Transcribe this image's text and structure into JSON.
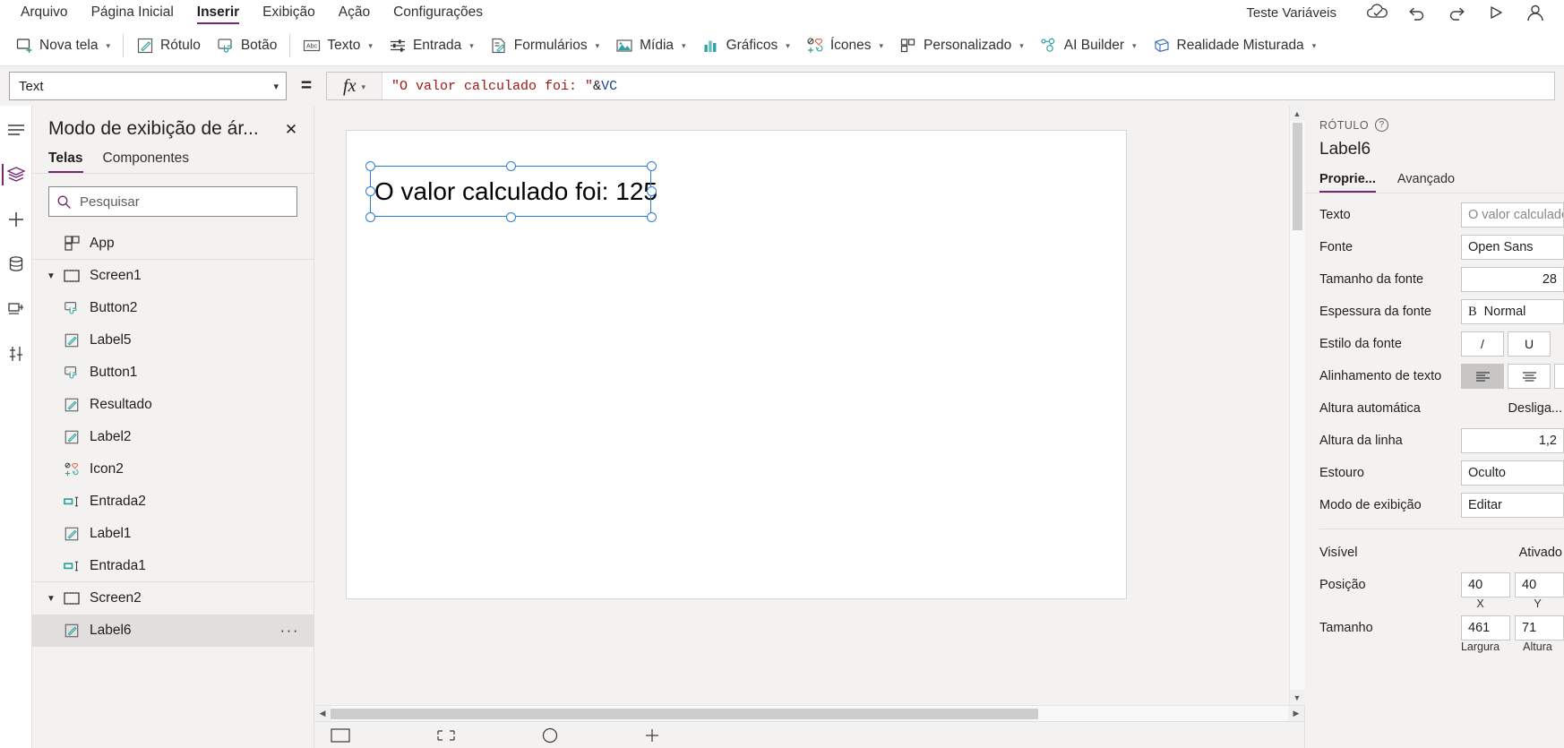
{
  "menubar": {
    "items": [
      {
        "label": "Arquivo",
        "active": false
      },
      {
        "label": "Página Inicial",
        "active": false
      },
      {
        "label": "Inserir",
        "active": true
      },
      {
        "label": "Exibição",
        "active": false
      },
      {
        "label": "Ação",
        "active": false
      },
      {
        "label": "Configurações",
        "active": false
      }
    ],
    "environment": "Teste Variáveis",
    "icons": [
      "cloud-check-icon",
      "undo-icon",
      "redo-icon",
      "play-icon",
      "account-icon"
    ]
  },
  "ribbon": {
    "groups": [
      {
        "items": [
          {
            "label": "Nova tela",
            "icon": "new-screen-icon",
            "caret": true
          }
        ]
      },
      {
        "items": [
          {
            "label": "Rótulo",
            "icon": "label-icon",
            "caret": false
          },
          {
            "label": "Botão",
            "icon": "button-icon",
            "caret": false
          }
        ]
      },
      {
        "items": [
          {
            "label": "Texto",
            "icon": "text-icon",
            "caret": true
          },
          {
            "label": "Entrada",
            "icon": "input-icon",
            "caret": true
          },
          {
            "label": "Formulários",
            "icon": "forms-icon",
            "caret": true
          },
          {
            "label": "Mídia",
            "icon": "media-icon",
            "caret": true
          },
          {
            "label": "Gráficos",
            "icon": "charts-icon",
            "caret": true
          },
          {
            "label": "Ícones",
            "icon": "icons-icon",
            "caret": true
          },
          {
            "label": "Personalizado",
            "icon": "custom-icon",
            "caret": true
          },
          {
            "label": "AI Builder",
            "icon": "ai-builder-icon",
            "caret": true
          },
          {
            "label": "Realidade Misturada",
            "icon": "mixed-reality-icon",
            "caret": true
          }
        ]
      }
    ]
  },
  "formula_bar": {
    "property_selected": "Text",
    "equals": "=",
    "fx_label": "fx",
    "formula_parts": [
      {
        "text": "\"O valor calculado foi: \"",
        "kind": "string"
      },
      {
        "text": "&",
        "kind": "operator"
      },
      {
        "text": "VC",
        "kind": "variable"
      }
    ]
  },
  "tree_panel": {
    "title": "Modo de exibição de ár...",
    "close_label": "✕",
    "tabs": [
      {
        "label": "Telas",
        "active": true
      },
      {
        "label": "Componentes",
        "active": false
      }
    ],
    "search_placeholder": "Pesquisar",
    "search_value": "",
    "items": [
      {
        "label": "App",
        "icon": "app-icon",
        "indent": 0,
        "chevron": "",
        "selected": false,
        "divider": true,
        "dots": false
      },
      {
        "label": "Screen1",
        "icon": "screen-icon",
        "indent": 0,
        "chevron": "expanded",
        "selected": false,
        "divider": false,
        "dots": false
      },
      {
        "label": "Button2",
        "icon": "button-icon",
        "indent": 1,
        "chevron": "",
        "selected": false,
        "divider": false,
        "dots": false
      },
      {
        "label": "Label5",
        "icon": "label-icon",
        "indent": 1,
        "chevron": "",
        "selected": false,
        "divider": false,
        "dots": false
      },
      {
        "label": "Button1",
        "icon": "button-icon",
        "indent": 1,
        "chevron": "",
        "selected": false,
        "divider": false,
        "dots": false
      },
      {
        "label": "Resultado",
        "icon": "label-icon",
        "indent": 1,
        "chevron": "",
        "selected": false,
        "divider": false,
        "dots": false
      },
      {
        "label": "Label2",
        "icon": "label-icon",
        "indent": 1,
        "chevron": "",
        "selected": false,
        "divider": false,
        "dots": false
      },
      {
        "label": "Icon2",
        "icon": "icons-icon",
        "indent": 1,
        "chevron": "",
        "selected": false,
        "divider": false,
        "dots": false
      },
      {
        "label": "Entrada2",
        "icon": "textinput-icon",
        "indent": 1,
        "chevron": "",
        "selected": false,
        "divider": false,
        "dots": false
      },
      {
        "label": "Label1",
        "icon": "label-icon",
        "indent": 1,
        "chevron": "",
        "selected": false,
        "divider": false,
        "dots": false
      },
      {
        "label": "Entrada1",
        "icon": "textinput-icon",
        "indent": 1,
        "chevron": "",
        "selected": false,
        "divider": true,
        "dots": false
      },
      {
        "label": "Screen2",
        "icon": "screen-icon",
        "indent": 0,
        "chevron": "expanded",
        "selected": false,
        "divider": false,
        "dots": false
      },
      {
        "label": "Label6",
        "icon": "label-icon",
        "indent": 1,
        "chevron": "",
        "selected": true,
        "divider": false,
        "dots": true
      }
    ],
    "more_dots": "···"
  },
  "canvas": {
    "label_text": "O valor calculado foi: 125"
  },
  "properties": {
    "kicker": "RÓTULO",
    "help_glyph": "?",
    "control_name": "Label6",
    "tabs": [
      {
        "label": "Proprie...",
        "active": true
      },
      {
        "label": "Avançado",
        "active": false
      }
    ],
    "rows": [
      {
        "label": "Texto",
        "type": "text",
        "value": "O valor calculado",
        "muted": true
      },
      {
        "label": "Fonte",
        "type": "text",
        "value": "Open Sans",
        "muted": false
      },
      {
        "label": "Tamanho da fonte",
        "type": "number",
        "value": "28"
      },
      {
        "label": "Espessura da fonte",
        "type": "weight",
        "value": "Normal",
        "prefix": "B"
      },
      {
        "label": "Estilo da fonte",
        "type": "buttons",
        "buttons": [
          {
            "glyph": "/",
            "pressed": false
          },
          {
            "glyph": "U",
            "pressed": false
          }
        ]
      },
      {
        "label": "Alinhamento de texto",
        "type": "align",
        "buttons": [
          {
            "glyph": "align-left-icon",
            "pressed": true
          },
          {
            "glyph": "align-center-icon",
            "pressed": false
          },
          {
            "glyph": "align-right-icon",
            "pressed": false
          }
        ]
      },
      {
        "label": "Altura automática",
        "type": "plain",
        "value": "Desliga..."
      },
      {
        "label": "Altura da linha",
        "type": "number",
        "value": "1,2"
      },
      {
        "label": "Estouro",
        "type": "text",
        "value": "Oculto",
        "muted": false
      },
      {
        "label": "Modo de exibição",
        "type": "text",
        "value": "Editar",
        "muted": false
      }
    ],
    "rows2": [
      {
        "label": "Visível",
        "type": "plain",
        "value": "Ativado"
      },
      {
        "label": "Posição",
        "type": "pair",
        "v1": "40",
        "v2": "40",
        "cap1": "X",
        "cap2": "Y"
      },
      {
        "label": "Tamanho",
        "type": "pair",
        "v1": "461",
        "v2": "71",
        "cap1": "Largura",
        "cap2": "Altura"
      }
    ]
  }
}
